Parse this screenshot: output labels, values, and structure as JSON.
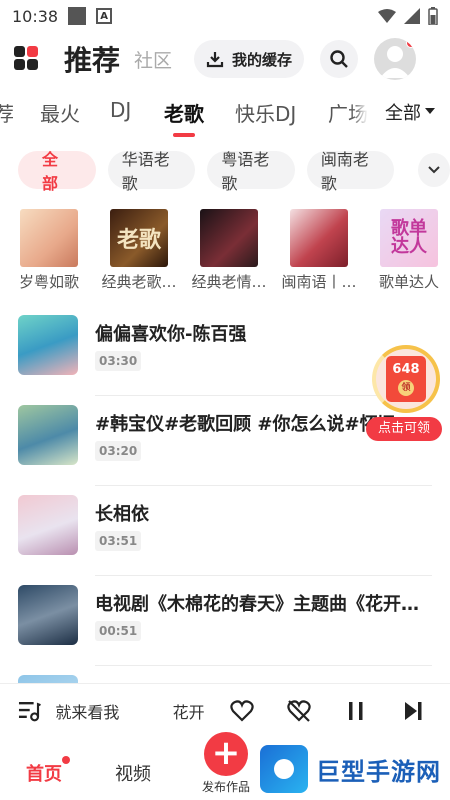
{
  "status_bar": {
    "time": "10:38"
  },
  "header": {
    "title": "推荐",
    "subtitle": "社区",
    "cache_label": "我的缓存"
  },
  "categories": {
    "tabs": [
      "荐",
      "最火",
      "DJ",
      "老歌",
      "快乐DJ",
      "广场"
    ],
    "active": "老歌",
    "all_label": "全部"
  },
  "chips": [
    "全部",
    "华语老歌",
    "粤语老歌",
    "闽南老歌"
  ],
  "playlists": [
    {
      "name": "岁粤如歌"
    },
    {
      "name": "经典老歌…",
      "cover_text": "老歌"
    },
    {
      "name": "经典老情…"
    },
    {
      "name": "闽南语丨…"
    },
    {
      "name": "歌单达人",
      "cover_text": "歌单达人"
    }
  ],
  "songs": [
    {
      "title": "偏偏喜欢你-陈百强",
      "duration": "03:30"
    },
    {
      "title": "#韩宝仪#老歌回顾 #你怎么说#怀旧",
      "duration": "03:20"
    },
    {
      "title": "长相依",
      "duration": "03:51"
    },
    {
      "title": "电视剧《木棉花的春天》主题曲《花开…",
      "duration": "00:51"
    }
  ],
  "reward": {
    "amount": "648",
    "coin": "领",
    "label": "点击可领"
  },
  "player": {
    "playlist_label": "就来看我",
    "now_playing": "花开"
  },
  "nav": {
    "home": "首页",
    "video": "视频",
    "publish": "发布作品"
  },
  "watermark": {
    "text": "巨型手游网"
  },
  "colors": {
    "accent": "#f23b44"
  }
}
